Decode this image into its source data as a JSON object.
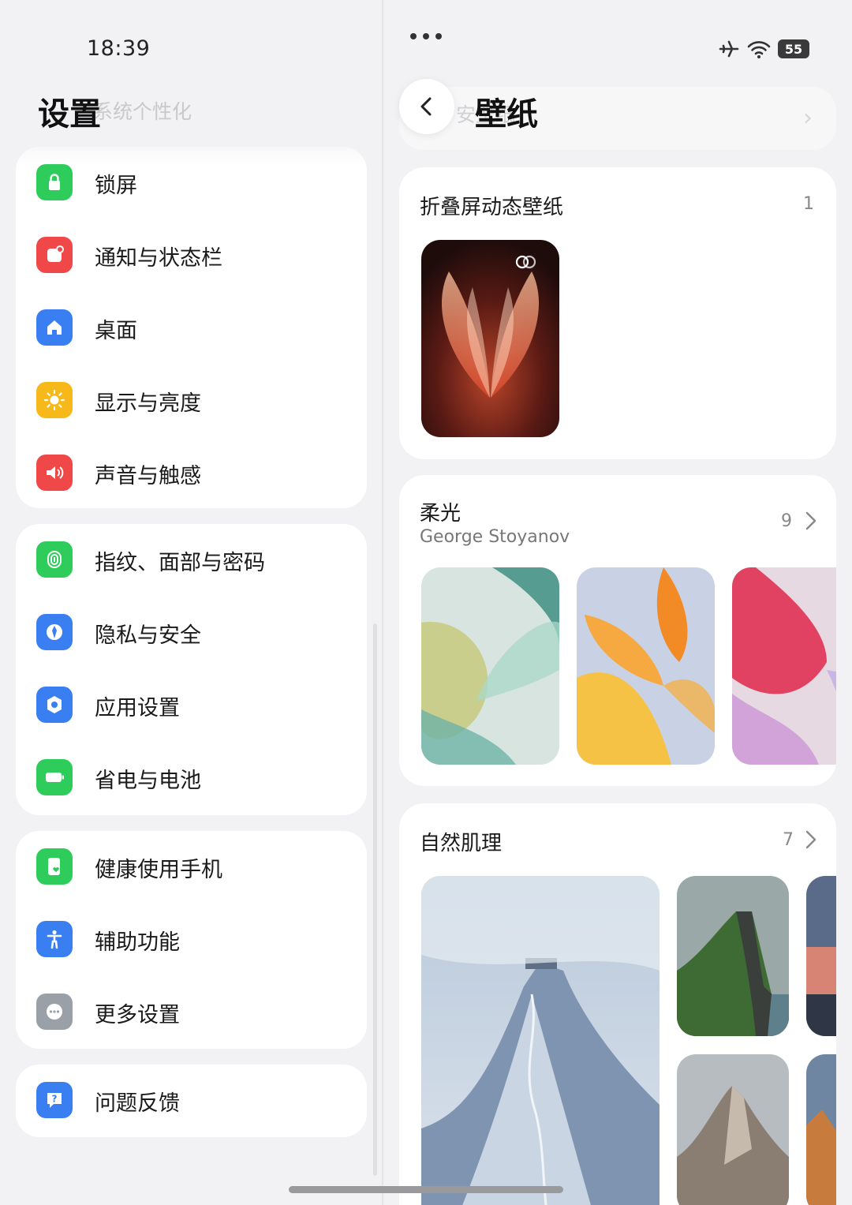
{
  "status_bar": {
    "time": "18:39",
    "battery": "55"
  },
  "left": {
    "title": "设置",
    "ghost_title": "系统个性化",
    "groups": [
      [
        {
          "label": "锁屏",
          "icon": "lock-icon",
          "color": "#2ecc5a"
        },
        {
          "label": "通知与状态栏",
          "icon": "notification-icon",
          "color": "#f04848"
        },
        {
          "label": "桌面",
          "icon": "home-icon",
          "color": "#3a7ff2"
        },
        {
          "label": "显示与亮度",
          "icon": "sun-icon",
          "color": "#f7b81a"
        },
        {
          "label": "声音与触感",
          "icon": "speaker-icon",
          "color": "#f04848"
        }
      ],
      [
        {
          "label": "指纹、面部与密码",
          "icon": "fingerprint-icon",
          "color": "#2ecc5a"
        },
        {
          "label": "隐私与安全",
          "icon": "privacy-icon",
          "color": "#3a7ff2"
        },
        {
          "label": "应用设置",
          "icon": "app-settings-icon",
          "color": "#3a7ff2"
        },
        {
          "label": "省电与电池",
          "icon": "battery-icon",
          "color": "#2ecc5a"
        }
      ],
      [
        {
          "label": "健康使用手机",
          "icon": "health-icon",
          "color": "#2ecc5a"
        },
        {
          "label": "辅助功能",
          "icon": "accessibility-icon",
          "color": "#3a7ff2"
        },
        {
          "label": "更多设置",
          "icon": "more-icon",
          "color": "#9aa0a8"
        }
      ],
      [
        {
          "label": "问题反馈",
          "icon": "feedback-icon",
          "color": "#3a7ff2"
        }
      ]
    ]
  },
  "right": {
    "title": "壁纸",
    "ghost_title": "安壁纸",
    "sections": [
      {
        "title": "折叠屏动态壁纸",
        "count": "1"
      },
      {
        "title": "柔光",
        "subtitle": "George Stoyanov",
        "count": "9"
      },
      {
        "title": "自然肌理",
        "count": "7"
      }
    ]
  }
}
